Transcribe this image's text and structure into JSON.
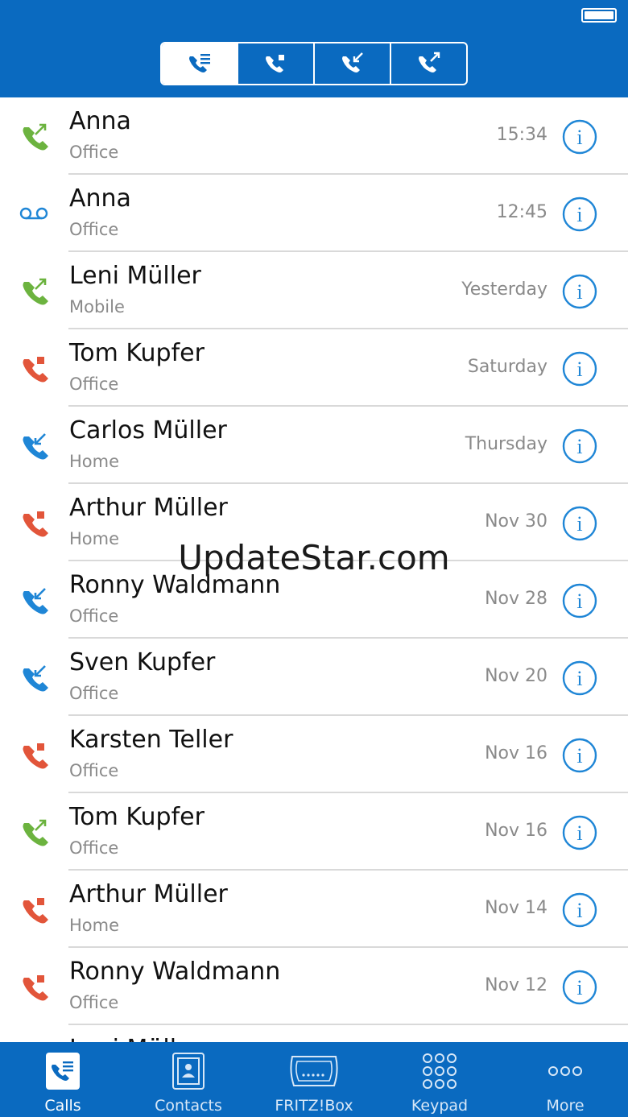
{
  "header": {
    "filters": [
      {
        "name": "all-calls",
        "active": true
      },
      {
        "name": "missed-calls",
        "active": false
      },
      {
        "name": "incoming-calls",
        "active": false
      },
      {
        "name": "outgoing-calls",
        "active": false
      }
    ]
  },
  "calls": [
    {
      "name": "Anna",
      "type": "Office",
      "time": "15:34",
      "kind": "outgoing"
    },
    {
      "name": "Anna",
      "type": "Office",
      "time": "12:45",
      "kind": "voicemail"
    },
    {
      "name": "Leni Müller",
      "type": "Mobile",
      "time": "Yesterday",
      "kind": "outgoing"
    },
    {
      "name": "Tom Kupfer",
      "type": "Office",
      "time": "Saturday",
      "kind": "missed"
    },
    {
      "name": "Carlos Müller",
      "type": "Home",
      "time": "Thursday",
      "kind": "incoming"
    },
    {
      "name": "Arthur Müller",
      "type": "Home",
      "time": "Nov 30",
      "kind": "missed"
    },
    {
      "name": "Ronny Waldmann",
      "type": "Office",
      "time": "Nov 28",
      "kind": "incoming"
    },
    {
      "name": "Sven Kupfer",
      "type": "Office",
      "time": "Nov 20",
      "kind": "incoming"
    },
    {
      "name": "Karsten Teller",
      "type": "Office",
      "time": "Nov 16",
      "kind": "missed"
    },
    {
      "name": "Tom Kupfer",
      "type": "Office",
      "time": "Nov 16",
      "kind": "outgoing"
    },
    {
      "name": "Arthur Müller",
      "type": "Home",
      "time": "Nov 14",
      "kind": "missed"
    },
    {
      "name": "Ronny Waldmann",
      "type": "Office",
      "time": "Nov 12",
      "kind": "missed"
    },
    {
      "name": "Leni Müller",
      "type": "",
      "time": "",
      "kind": "outgoing"
    }
  ],
  "watermark": "UpdateStar.com",
  "tabs": [
    {
      "label": "Calls",
      "icon": "calls-icon",
      "active": true
    },
    {
      "label": "Contacts",
      "icon": "contacts-icon",
      "active": false
    },
    {
      "label": "FRITZ!Box",
      "icon": "fritzbox-icon",
      "active": false
    },
    {
      "label": "Keypad",
      "icon": "keypad-icon",
      "active": false
    },
    {
      "label": "More",
      "icon": "more-icon",
      "active": false
    }
  ],
  "colors": {
    "brand": "#0a6ac0",
    "outgoing": "#6cb33f",
    "missed": "#e2553a",
    "incoming": "#1f86d6",
    "voicemail": "#1f86d6"
  }
}
